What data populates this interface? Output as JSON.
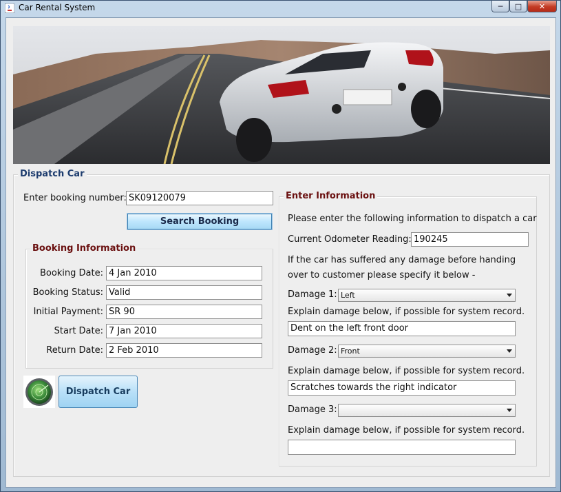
{
  "window": {
    "title": "Car Rental System"
  },
  "dispatch": {
    "legend": "Dispatch Car",
    "booking_label": "Enter booking number:",
    "booking_value": "SK09120079",
    "search_button": "Search Booking",
    "dispatch_button": "Dispatch Car"
  },
  "booking_info": {
    "legend": "Booking Information",
    "rows": [
      {
        "label": "Booking Date:",
        "value": "4 Jan 2010"
      },
      {
        "label": "Booking Status:",
        "value": "Valid"
      },
      {
        "label": "Initial Payment:",
        "value": "SR 90"
      },
      {
        "label": "Start Date:",
        "value": "7 Jan 2010"
      },
      {
        "label": "Return Date:",
        "value": "2 Feb 2010"
      }
    ]
  },
  "enter_info": {
    "legend": "Enter Information",
    "intro": "Please enter the following information to dispatch a car",
    "odometer_label": "Current Odometer Reading:",
    "odometer_value": "190245",
    "damage_note_line1": "If the car has suffered any damage before handing",
    "damage_note_line2": "over to customer please specify it below -",
    "damages": [
      {
        "label": "Damage 1:",
        "selected": "Left",
        "explain": "Explain damage below, if possible for system record.",
        "text": "Dent on the left front door"
      },
      {
        "label": "Damage 2:",
        "selected": "Front",
        "explain": "Explain damage below, if possible for system record.",
        "text": "Scratches towards the right indicator"
      },
      {
        "label": "Damage 3:",
        "selected": "",
        "explain": "Explain damage below, if possible for system record.",
        "text": ""
      }
    ]
  },
  "colors": {
    "legend_blue": "#1d3c6e",
    "legend_red": "#6a1010"
  }
}
